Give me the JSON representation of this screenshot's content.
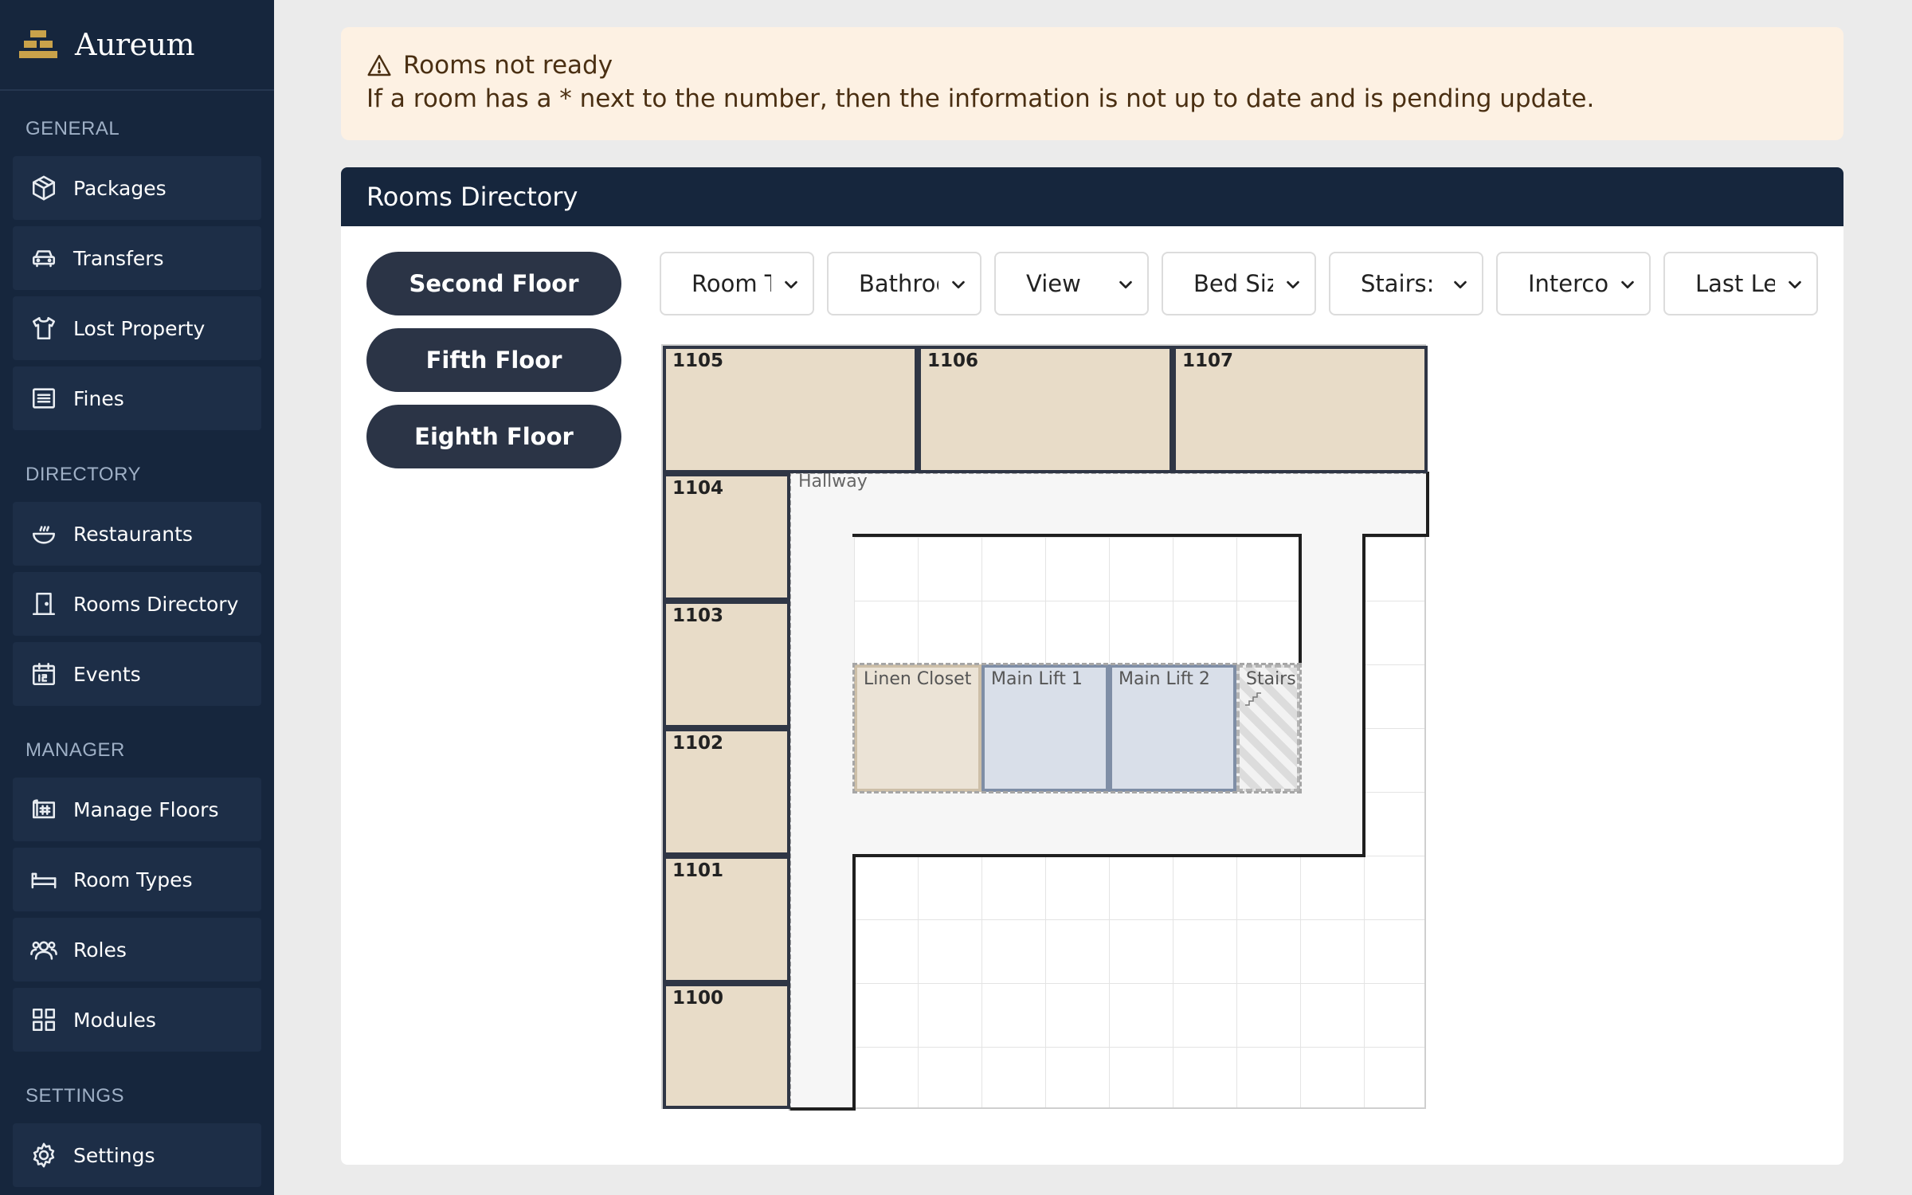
{
  "brand": {
    "name": "Aureum",
    "logo_icon": "gold-bars-logo"
  },
  "sidebar": {
    "sections": [
      {
        "title": "GENERAL",
        "items": [
          {
            "label": "Packages",
            "icon": "package-icon"
          },
          {
            "label": "Transfers",
            "icon": "car-icon"
          },
          {
            "label": "Lost Property",
            "icon": "shirt-icon"
          },
          {
            "label": "Fines",
            "icon": "list-icon"
          }
        ]
      },
      {
        "title": "DIRECTORY",
        "items": [
          {
            "label": "Restaurants",
            "icon": "bowl-icon"
          },
          {
            "label": "Rooms Directory",
            "icon": "door-icon"
          },
          {
            "label": "Events",
            "icon": "calendar-icon"
          }
        ]
      },
      {
        "title": "MANAGER",
        "items": [
          {
            "label": "Manage Floors",
            "icon": "floorplan-icon"
          },
          {
            "label": "Room Types",
            "icon": "bed-icon"
          },
          {
            "label": "Roles",
            "icon": "users-icon"
          },
          {
            "label": "Modules",
            "icon": "grid-icon"
          }
        ]
      },
      {
        "title": "SETTINGS",
        "items": [
          {
            "label": "Settings",
            "icon": "gear-icon"
          }
        ]
      }
    ]
  },
  "alert": {
    "title": "Rooms not ready",
    "message": "If a room has a * next to the number, then the information is not up to date and is pending update.",
    "icon": "warning-icon"
  },
  "card": {
    "title": "Rooms Directory"
  },
  "floors": [
    "Second Floor",
    "Fifth Floor",
    "Eighth Floor"
  ],
  "filters": [
    "Room Type",
    "Bathroom",
    "View",
    "Bed Size",
    "Stairs:",
    "Intercom",
    "Last Level"
  ],
  "floorplan": {
    "rooms": [
      "1105",
      "1106",
      "1107",
      "1104",
      "1103",
      "1102",
      "1101",
      "1100"
    ],
    "hallway": "Hallway",
    "amenities": [
      "Linen Closet",
      "Main Lift 1",
      "Main Lift 2",
      "Stairs"
    ]
  },
  "colors": {
    "sidebar": "#16263d",
    "room_fill": "#e8dcc8",
    "lift_fill": "#d9dfe9",
    "alert_bg": "#fdf1e3"
  }
}
